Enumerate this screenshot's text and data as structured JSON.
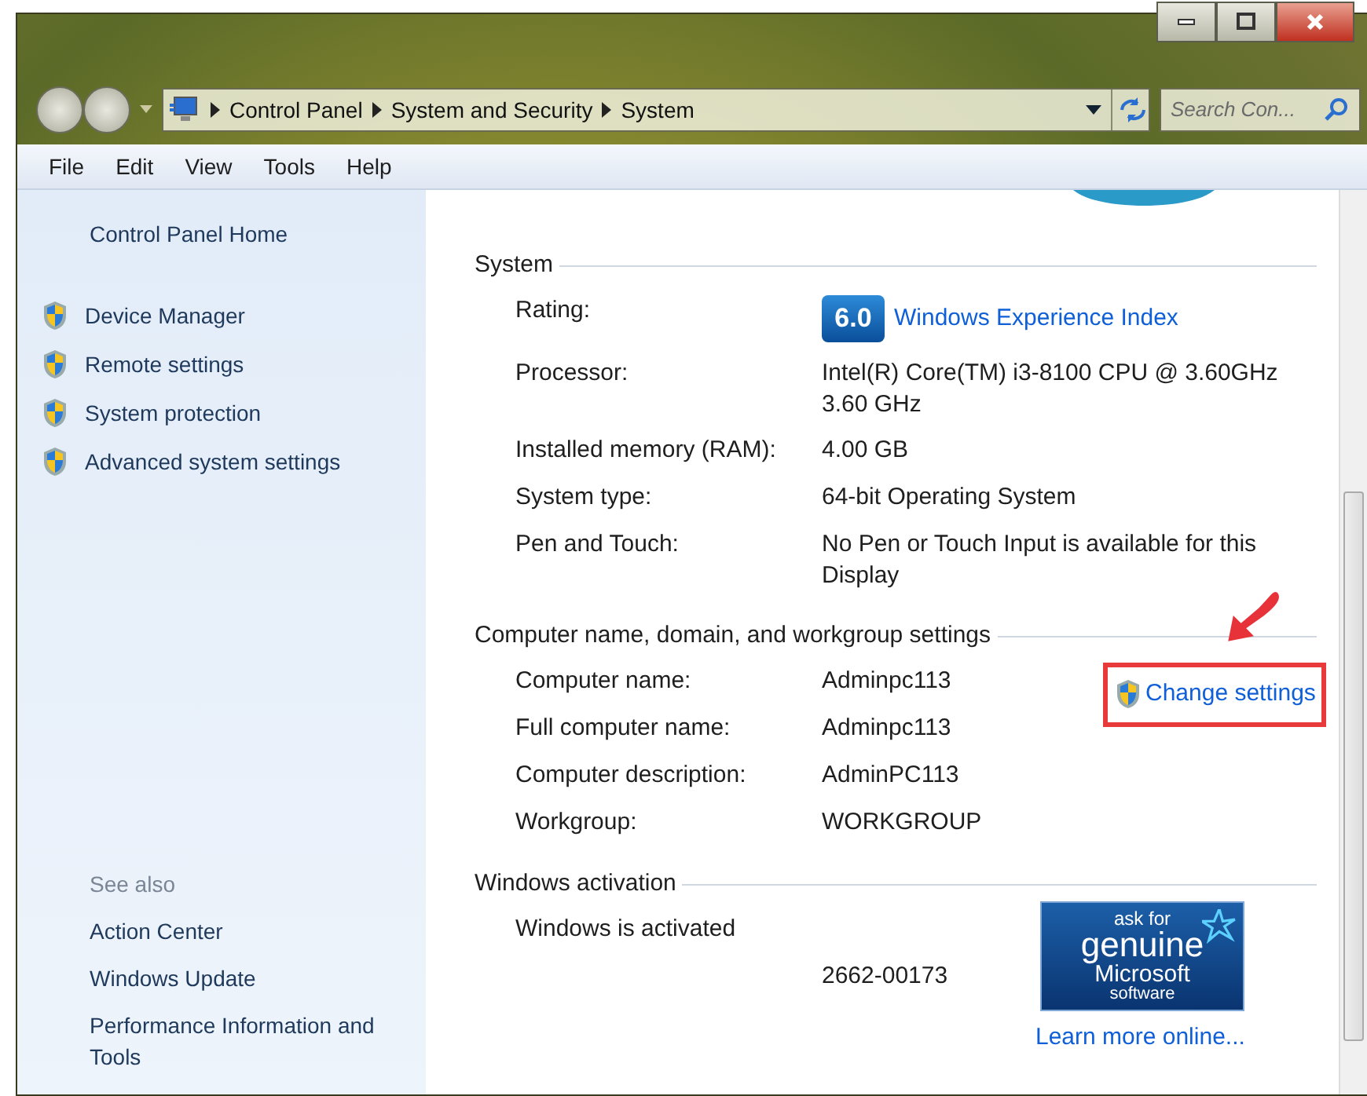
{
  "address_bar": {
    "breadcrumbs": [
      "Control Panel",
      "System and Security",
      "System"
    ]
  },
  "search": {
    "placeholder": "Search Con..."
  },
  "menu": [
    "File",
    "Edit",
    "View",
    "Tools",
    "Help"
  ],
  "sidebar": {
    "home": "Control Panel Home",
    "tasks": [
      "Device Manager",
      "Remote settings",
      "System protection",
      "Advanced system settings"
    ],
    "see_also": {
      "heading": "See also",
      "links": [
        "Action Center",
        "Windows Update",
        "Performance Information and Tools"
      ]
    }
  },
  "sections": [
    {
      "heading": "System",
      "rows": [
        {
          "kind": "rating",
          "label": "Rating:",
          "score": "6.0",
          "value": "Windows Experience Index"
        },
        {
          "kind": "text",
          "label": "Processor:",
          "value": "Intel(R) Core(TM) i3-8100 CPU @ 3.60GHz 3.60 GHz"
        },
        {
          "kind": "text",
          "label": "Installed memory (RAM):",
          "value": "4.00 GB"
        },
        {
          "kind": "text",
          "label": "System type:",
          "value": "64-bit Operating System"
        },
        {
          "kind": "text",
          "label": "Pen and Touch:",
          "value": "No Pen or Touch Input is available for this Display"
        }
      ]
    },
    {
      "heading": "Computer name, domain, and workgroup settings",
      "action": {
        "label": "Change settings",
        "highlighted": true
      },
      "rows": [
        {
          "kind": "text",
          "label": "Computer name:",
          "value": "Adminpc113"
        },
        {
          "kind": "text",
          "label": "Full computer name:",
          "value": "Adminpc113"
        },
        {
          "kind": "text",
          "label": "Computer description:",
          "value": "AdminPC113"
        },
        {
          "kind": "text",
          "label": "Workgroup:",
          "value": "WORKGROUP"
        }
      ]
    },
    {
      "heading": "Windows activation",
      "rows": [
        {
          "kind": "full",
          "value": "Windows is activated"
        },
        {
          "kind": "text",
          "label": "",
          "value": "2662-00173"
        }
      ],
      "badge": {
        "lines": [
          "ask for",
          "genuine",
          "Microsoft",
          "software"
        ]
      },
      "link": "Learn more online..."
    }
  ]
}
